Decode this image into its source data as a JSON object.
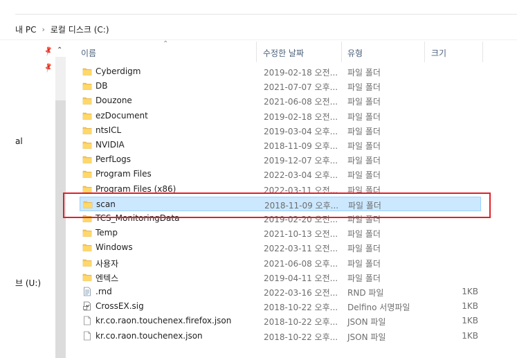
{
  "breadcrumb": {
    "items": [
      "내 PC",
      "로컬 디스크 (C:)"
    ],
    "separator": "›"
  },
  "nav": {
    "partial_labels": [
      "al",
      "브 (U:)"
    ]
  },
  "columns": {
    "name": "이름",
    "modified": "수정한 날짜",
    "type": "유형",
    "size": "크기"
  },
  "files": [
    {
      "name": "Cyberdigm",
      "date": "2019-02-18 오전...",
      "type": "파일 폴더",
      "size": "",
      "icon": "folder-icon"
    },
    {
      "name": "DB",
      "date": "2021-07-07 오후...",
      "type": "파일 폴더",
      "size": "",
      "icon": "folder-icon"
    },
    {
      "name": "Douzone",
      "date": "2021-06-08 오전...",
      "type": "파일 폴더",
      "size": "",
      "icon": "folder-icon"
    },
    {
      "name": "ezDocument",
      "date": "2019-02-18 오전...",
      "type": "파일 폴더",
      "size": "",
      "icon": "folder-icon"
    },
    {
      "name": "ntsICL",
      "date": "2019-03-04 오후...",
      "type": "파일 폴더",
      "size": "",
      "icon": "folder-icon"
    },
    {
      "name": "NVIDIA",
      "date": "2018-11-09 오후...",
      "type": "파일 폴더",
      "size": "",
      "icon": "folder-icon"
    },
    {
      "name": "PerfLogs",
      "date": "2019-12-07 오후...",
      "type": "파일 폴더",
      "size": "",
      "icon": "folder-icon"
    },
    {
      "name": "Program Files",
      "date": "2022-03-04 오후...",
      "type": "파일 폴더",
      "size": "",
      "icon": "folder-icon"
    },
    {
      "name": "Program Files (x86)",
      "date": "2022-03-11 오전...",
      "type": "파일 폴더",
      "size": "",
      "icon": "folder-icon"
    },
    {
      "name": "scan",
      "date": "2018-11-09 오후...",
      "type": "파일 폴더",
      "size": "",
      "icon": "folder-icon",
      "selected": true
    },
    {
      "name": "TCS_MonitoringData",
      "date": "2019-02-20 오전...",
      "type": "파일 폴더",
      "size": "",
      "icon": "folder-icon"
    },
    {
      "name": "Temp",
      "date": "2021-10-13 오전...",
      "type": "파일 폴더",
      "size": "",
      "icon": "folder-icon"
    },
    {
      "name": "Windows",
      "date": "2022-03-11 오전...",
      "type": "파일 폴더",
      "size": "",
      "icon": "folder-icon"
    },
    {
      "name": "사용자",
      "date": "2021-06-08 오후...",
      "type": "파일 폴더",
      "size": "",
      "icon": "folder-icon"
    },
    {
      "name": "엔텍스",
      "date": "2019-04-11 오전...",
      "type": "파일 폴더",
      "size": "",
      "icon": "folder-icon"
    },
    {
      "name": ".rnd",
      "date": "2022-03-16 오전...",
      "type": "RND 파일",
      "size": "1KB",
      "icon": "text-file-icon"
    },
    {
      "name": "CrossEX.sig",
      "date": "2018-10-22 오후...",
      "type": "Delfino 서명파일",
      "size": "1KB",
      "icon": "signature-file-icon"
    },
    {
      "name": "kr.co.raon.touchenex.firefox.json",
      "date": "2018-10-22 오후...",
      "type": "JSON 파일",
      "size": "1KB",
      "icon": "blank-file-icon"
    },
    {
      "name": "kr.co.raon.touchenex.json",
      "date": "2018-10-22 오후...",
      "type": "JSON 파일",
      "size": "1KB",
      "icon": "blank-file-icon"
    }
  ],
  "colors": {
    "selection": "#cce8ff",
    "selection_border": "#99d1ff",
    "highlight": "#e0202a",
    "folder": "#f4c55c"
  }
}
